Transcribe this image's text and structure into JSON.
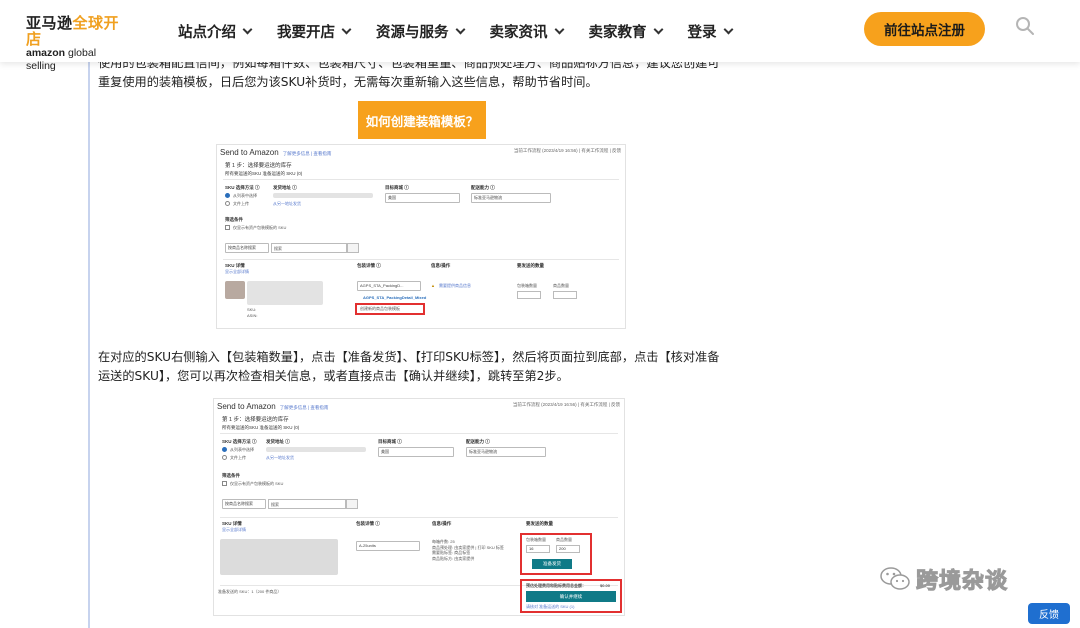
{
  "header": {
    "logo_cn_part1": "亚马逊",
    "logo_cn_part2": "全球开店",
    "logo_en_bold": "amazon",
    "logo_en_rest": " global selling",
    "nav": [
      {
        "label": "站点介绍"
      },
      {
        "label": "我要开店"
      },
      {
        "label": "资源与服务"
      },
      {
        "label": "卖家资讯"
      },
      {
        "label": "卖家教育"
      },
      {
        "label": "登录"
      }
    ],
    "cta_label": "前往站点注册",
    "accent": "#f7a11c"
  },
  "content": {
    "para1": "使用的包装箱配置信间，例如每箱件数、包装箱尺寸、包装箱重量、商品预处理方、商品贴标方信息，建议您创建可重复使用的装箱模板，日后您为该SKU补货时，无需每次重新输入这些信息，帮助节省时间。",
    "orange_button": "如何创建装箱模板？",
    "para2": "在对应的SKU右侧输入【包装箱数量】，点击【准备发货】、【打印SKU标签】，然后将页面拉到底部，点击【核对准备运送的SKU】，您可以再次检查相关信息，或者直接点击【确认并继续】，跳转至第2步。"
  },
  "screenshot1": {
    "title": "Send to Amazon",
    "title_link": "了解更多信息 | 查看指南",
    "topright": "当前工作流程 (2023/4/19 16:56) | 有关工作流程 | 反馈",
    "step": "第 1 步：选择要运送的库存",
    "tabs": "所有要运送的SKU    准备运送的 SKU (0)",
    "col_sku_method": "SKU 选择方法 ⓘ",
    "col_ship_from": "发货地址 ⓘ",
    "col_marketplace": "目标商城 ⓘ",
    "col_fulfillment": "配送能力 ⓘ",
    "radio1": "从列表中选择",
    "radio2": "文件上传",
    "ship_from_link": "从另一地址发货",
    "marketplace_value": "美国",
    "fulfillment_value": "标准亚马逊物流",
    "filter_label": "筛选条件",
    "filter_check": "仅显示有资产包装模板的 SKU",
    "search_select": "按商品名称搜索",
    "search_placeholder": "搜索",
    "table_sku": "SKU 详情",
    "table_sku_link": "显示全部详情",
    "table_pack": "包装详情 ⓘ",
    "table_info": "信息/操作",
    "table_qty": "要发送的数量",
    "pack_select": "AGPS_STA_PackingD...",
    "pack_dropdown_item": "AGPS_STA_PackingDetail_Mixed",
    "create_template": "创建新的商品包装模板",
    "warn_link": "需要提供商品信息",
    "qty_boxes": "包装箱数量",
    "qty_units": "商品数量",
    "sku_label": "SKU:",
    "asin_label": "ASIN:"
  },
  "screenshot2": {
    "title": "Send to Amazon",
    "title_link": "了解更多信息 | 查看指南",
    "topright": "当前工作流程 (2023/4/19 16:56) | 有关工作流程 | 反馈",
    "step": "第 1 步：选择要运送的库存",
    "tabs": "所有要运送的SKU    准备运送的 SKU (0)",
    "col_sku_method": "SKU 选择方法 ⓘ",
    "col_ship_from": "发货地址 ⓘ",
    "col_marketplace": "目标商城 ⓘ",
    "col_fulfillment": "配送能力 ⓘ",
    "radio1": "从列表中选择",
    "radio2": "文件上传",
    "ship_from_link": "从另一地址发货",
    "marketplace_value": "美国",
    "fulfillment_value": "标准亚马逊物流",
    "filter_label": "筛选条件",
    "filter_check": "仅显示有资产包装模板的 SKU",
    "search_select": "按商品名称搜索",
    "search_placeholder": "搜索",
    "table_sku": "SKU 详情",
    "table_sku_link": "显示全部详情",
    "table_pack": "包装详情 ⓘ",
    "table_info": "信息/操作",
    "table_qty": "要发送的数量",
    "pack_select": "A-25units",
    "info_text": "每箱件数: 25\n商品预处理: 由卖家提供 | 打印 SKU 标签\n需要贴标签: 商品标签\n商品贴标方: 由卖家提供",
    "qty_boxes": "包装箱数量",
    "qty_units": "商品数量",
    "qty_boxes_value": "16",
    "qty_units_value": "200",
    "ready_button": "准备发货",
    "fee_label": "预估处理费用和贴标费用总金额：",
    "fee_value": "$0.00",
    "confirm_button": "确认并继续",
    "review_link": "请核对 准备运送的 SKU (1)",
    "footer_text": "准备发送的 SKU：1（200 件商品）"
  },
  "watermark": "跨境杂谈",
  "feedback_button": "反馈"
}
